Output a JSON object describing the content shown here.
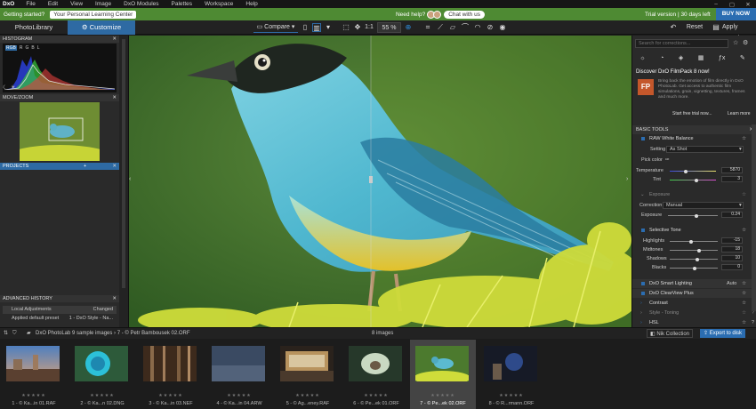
{
  "menubar": {
    "logo": "DxO",
    "items": [
      "File",
      "Edit",
      "View",
      "Image",
      "DxO Modules",
      "Palettes",
      "Workspace",
      "Help"
    ],
    "minimize": "–",
    "maximize": "▢",
    "close": "✕"
  },
  "greenbar": {
    "getting_started": "Getting started?",
    "learning_center": "Your Personal Learning Center",
    "need_help": "Need help?",
    "chat": "Chat with us",
    "trial": "Trial version | 30 days left",
    "buy": "BUY NOW"
  },
  "tabs": {
    "photolibrary": "PhotoLibrary",
    "customize": "Customize"
  },
  "toolbar": {
    "compare": "Compare",
    "zoom_1to1": "1:1",
    "zoom_pct": "55 %",
    "reset": "Reset",
    "apply_preset": "Apply preset"
  },
  "left": {
    "histogram": "HISTOGRAM",
    "channels": [
      "RGB",
      "R",
      "G",
      "B",
      "L"
    ],
    "movezoom": "MOVE/ZOOM",
    "projects": "PROJECTS",
    "projects_add": "+",
    "advanced_history": "ADVANCED HISTORY",
    "local_adjustments": "Local Adjustments",
    "changed": "Changed",
    "applied": "Applied default preset",
    "applied_val": "1 - DxO Style - Na..."
  },
  "right": {
    "search_placeholder": "Search for corrections...",
    "fp_logo": "FP",
    "discover_title": "Discover DxO FilmPack 8 now!",
    "discover_text": "Bring back the emotion of film directly in DxO PhotoLab. Get access to authentic film simulations, grain, vignetting, textures, frames and much more.",
    "free_trial": "Start free trial now...",
    "learn_more": "Learn more",
    "basic_tools": "BASIC TOOLS",
    "raw_wb": "RAW White Balance",
    "setting_label": "Setting",
    "setting_value": "As Shot",
    "pick_color": "Pick color",
    "temperature": "Temperature",
    "temperature_val": "5870",
    "tint": "Tint",
    "tint_val": "3",
    "exposure": "Exposure",
    "correction": "Correction",
    "correction_val": "Manual",
    "exposure_label": "Exposure",
    "exposure_val": "0.24",
    "selective_tone": "Selective Tone",
    "highlights": "Highlights",
    "highlights_val": "-15",
    "midtones": "Midtones",
    "midtones_val": "18",
    "shadows": "Shadows",
    "shadows_val": "10",
    "blacks": "Blacks",
    "blacks_val": "0",
    "smart_lighting": "DxO Smart Lighting",
    "smart_lighting_val": "Auto",
    "clearview": "DxO ClearView Plus",
    "contrast": "Contrast",
    "style_toning": "Style - Toning",
    "hsl": "HSL"
  },
  "filmbar": {
    "path": "DxO PhotoLab 9 sample images › 7 - © Petr Bambousek 02.ORF",
    "count": "8 images",
    "nik": "Nik Collection",
    "export": "Export to disk"
  },
  "thumbs": [
    {
      "name": "1 - © Ka...in 01.RAF",
      "stars": "★★★★★"
    },
    {
      "name": "2 - © Ka...n 02.DNG",
      "stars": "★★★★★"
    },
    {
      "name": "3 - © Ka...in 03.NEF",
      "stars": "★★★★★"
    },
    {
      "name": "4 - © Ka...in 04.ARW",
      "stars": "★★★★★"
    },
    {
      "name": "5 - © Ag...eney.RAF",
      "stars": "★★★★★"
    },
    {
      "name": "6 - © Pe...ek 01.ORF",
      "stars": "★★★★★"
    },
    {
      "name": "7 - © Pe...ek 02.ORF",
      "stars": "★★★★★"
    },
    {
      "name": "8 - © R...rmann.ORF",
      "stars": "★★★★★"
    }
  ],
  "colors": {
    "accent": "#2e6aa3",
    "green_bar": "#4e8a33",
    "buy": "#2b6db1"
  }
}
